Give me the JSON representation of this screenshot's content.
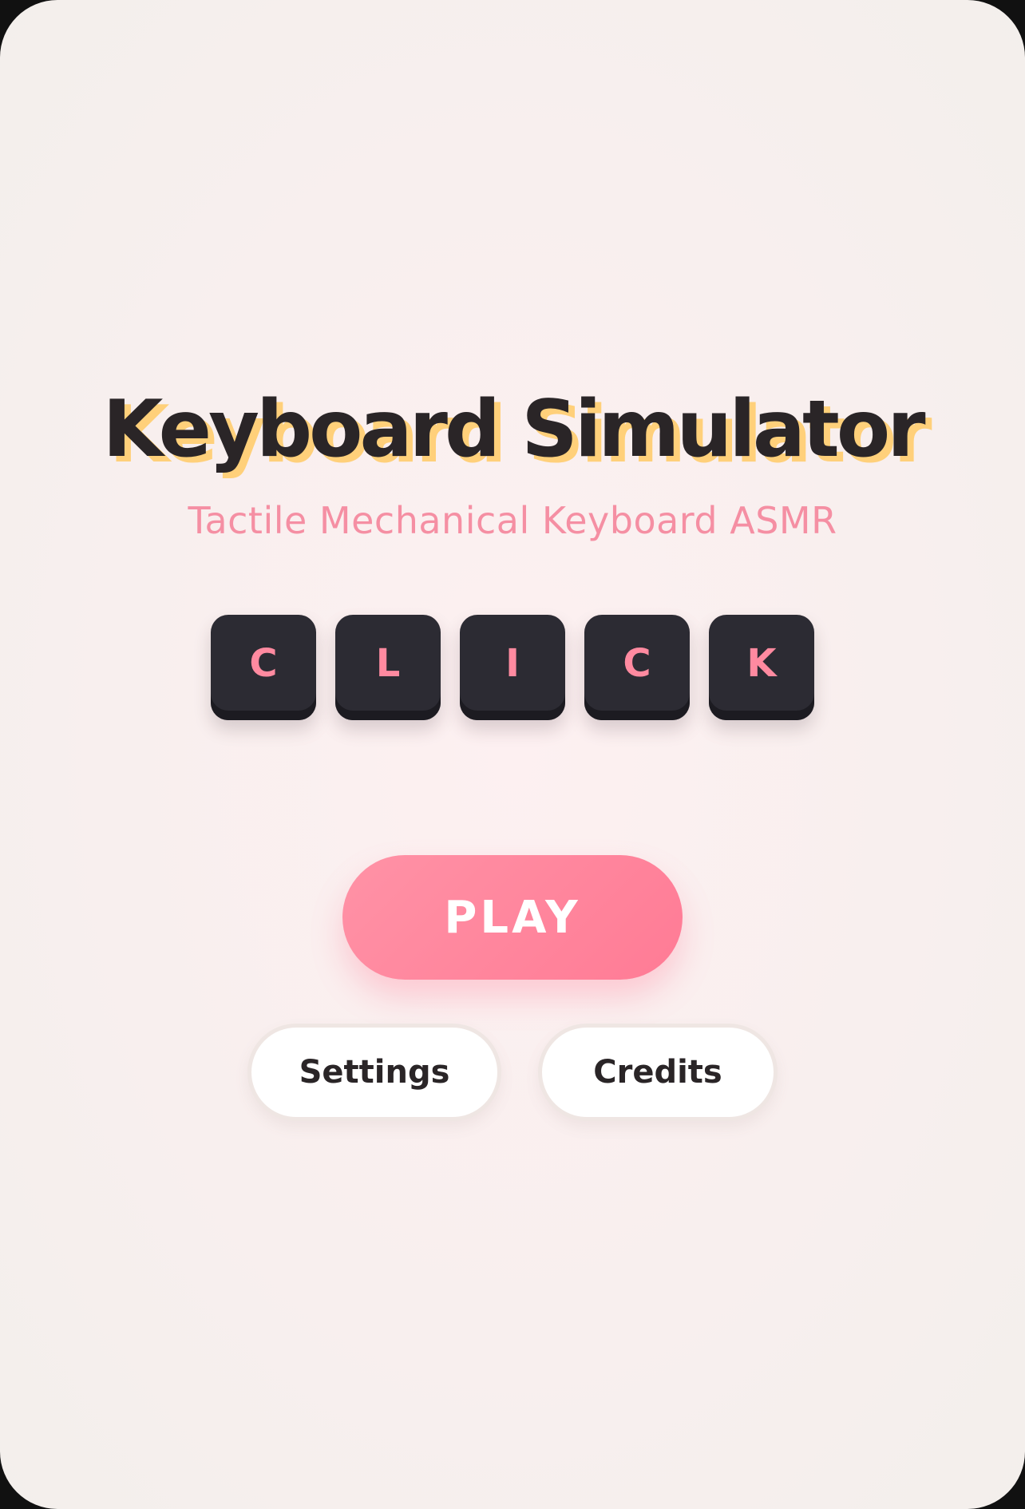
{
  "title": "Keyboard Simulator",
  "subtitle": "Tactile Mechanical Keyboard ASMR",
  "keycaps": [
    "C",
    "L",
    "I",
    "C",
    "K"
  ],
  "menu": {
    "play_label": "PLAY",
    "settings_label": "Settings",
    "credits_label": "Credits"
  },
  "colors": {
    "title_text": "#2a2527",
    "title_shadow": "#ffd07a",
    "accent_pink": "#ff8aa0",
    "keycap_body": "#2c2b33",
    "background": "#f8efee"
  }
}
